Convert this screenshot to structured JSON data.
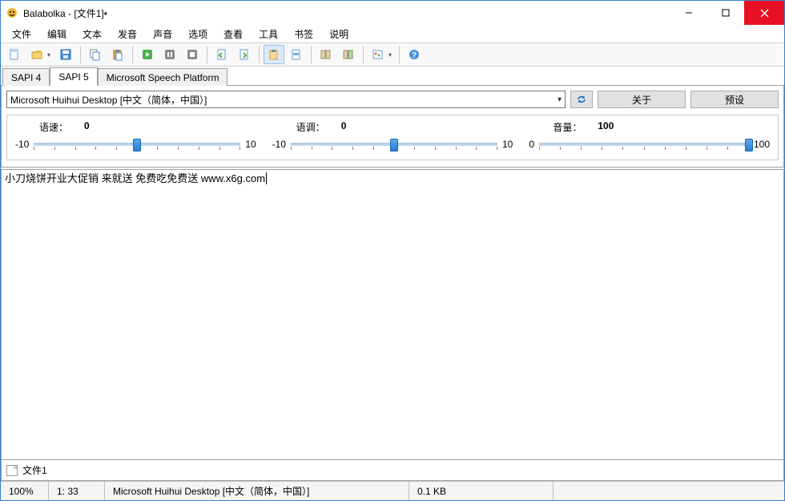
{
  "window": {
    "title": "Balabolka - [文件1]•"
  },
  "menu": {
    "items": [
      "文件",
      "编辑",
      "文本",
      "发音",
      "声音",
      "选项",
      "查看",
      "工具",
      "书签",
      "说明"
    ]
  },
  "toolbar_icons": {
    "new": "new-file-icon",
    "open": "open-folder-icon",
    "save": "save-icon",
    "copy": "copy-icon",
    "paste": "paste-icon",
    "play": "play-icon",
    "pause": "pause-icon",
    "stop": "stop-icon",
    "prev": "prev-icon",
    "next": "next-icon",
    "read_clip": "clipboard-read-icon",
    "highlight": "highlight-icon",
    "dict1": "dictionary-icon",
    "dict2": "dictionary2-icon",
    "settings": "settings-icon",
    "help": "help-icon"
  },
  "tabs": {
    "items": [
      "SAPI 4",
      "SAPI 5",
      "Microsoft Speech Platform"
    ],
    "active": 1
  },
  "voice": {
    "selected": "Microsoft Huihui Desktop [中文（简体，中国）]",
    "refresh_icon": "refresh-icon",
    "about_btn": "关于",
    "preset_btn": "预设"
  },
  "sliders": {
    "rate": {
      "label": "语速：",
      "value": "0",
      "min": "-10",
      "max": "10",
      "pos": 50
    },
    "pitch": {
      "label": "语调：",
      "value": "0",
      "min": "-10",
      "max": "10",
      "pos": 50
    },
    "volume": {
      "label": "音量：",
      "value": "100",
      "min": "0",
      "max": "100",
      "pos": 100
    }
  },
  "editor": {
    "text": "小刀烧饼开业大促销 来就送 免费吃免费送 www.x6g.com"
  },
  "doc_tab": {
    "name": "文件1"
  },
  "status": {
    "zoom": "100%",
    "pos": "1:  33",
    "voice": "Microsoft Huihui Desktop [中文（简体，中国）]",
    "size": "0.1 KB"
  }
}
